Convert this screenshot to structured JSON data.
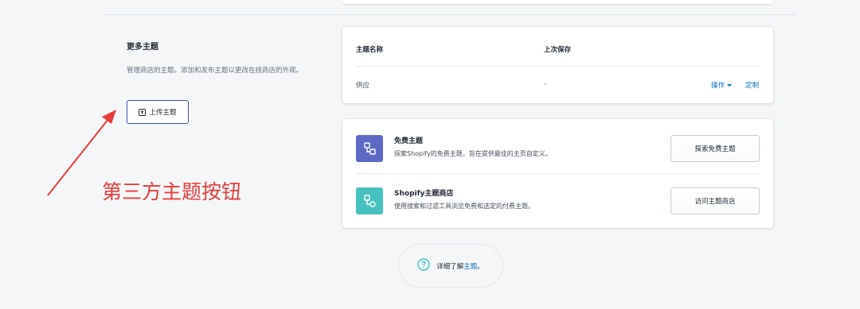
{
  "more_themes": {
    "title": "更多主题",
    "description": "管理商店的主题。添加和发布主题以更改在线商店的外观。",
    "upload_button": "上传主题"
  },
  "themes_table": {
    "col_name": "主题名称",
    "col_saved": "上次保存",
    "rows": [
      {
        "name": "供应",
        "saved": "-",
        "actions_label": "操作",
        "customize_label": "定制"
      }
    ]
  },
  "theme_sources": [
    {
      "title": "免费主题",
      "description": "探索Shopify的免费主题，旨在提供最佳的主页自定义。",
      "button": "探索免费主题",
      "icon": "free-themes-icon",
      "color": "#5c6ac4"
    },
    {
      "title": "Shopify主题商店",
      "description": "使用搜索和过滤工具浏览免费和选定的付费主题。",
      "button": "访问主题商店",
      "icon": "theme-store-icon",
      "color": "#47c1bf"
    }
  ],
  "learn_more": {
    "prefix": "详细了解",
    "link": "主题",
    "suffix": "。"
  },
  "annotation": {
    "text": "第三方主题按钮",
    "color": "#e83c3c"
  }
}
